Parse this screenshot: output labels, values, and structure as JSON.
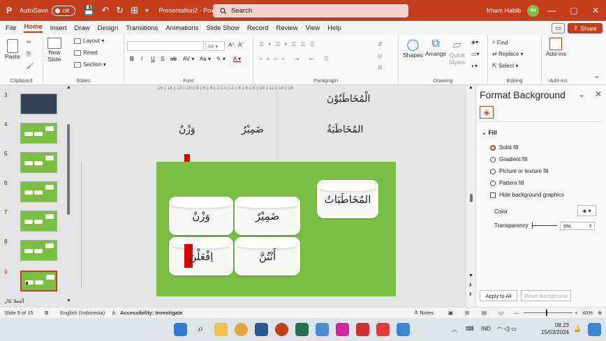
{
  "titlebar": {
    "autosave_label": "AutoSave",
    "autosave_state": "Off",
    "doc_name": "Presentation2 - PowerP...",
    "search_placeholder": "Search",
    "user_name": "Irham Habib",
    "user_initials": "IH"
  },
  "menu": {
    "items": [
      "File",
      "Home",
      "Insert",
      "Draw",
      "Design",
      "Transitions",
      "Animations",
      "Slide Show",
      "Record",
      "Review",
      "View",
      "Help"
    ],
    "share_label": "Share"
  },
  "ribbon": {
    "paste": "Paste",
    "new_slide": "New\nSlide",
    "layout": "Layout",
    "reset": "Reset",
    "section": "Section",
    "font_size": "54",
    "shapes": "Shapes",
    "arrange": "Arrange",
    "quick_styles": "Quick\nStyles",
    "find": "Find",
    "replace": "Replace",
    "select": "Select",
    "addins": "Add-ins",
    "groups": {
      "clipboard": "Clipboard",
      "slides": "Slides",
      "font": "Font",
      "paragraph": "Paragraph",
      "drawing": "Drawing",
      "editing": "Editing",
      "addins": "Add-ins"
    }
  },
  "thumbnails": {
    "numbers": [
      "3",
      "4",
      "5",
      "6",
      "7",
      "8",
      "9"
    ],
    "selected": "9",
    "bottom_label": "ألفعلا ثلال"
  },
  "canvas": {
    "ruler_text": "16·|·14·|·12·|·10·|·8·|·6·|·4·|·2·|·0·|·2·|·4·|·6·|·8·|·10·|·12·|·14·|·16",
    "bg_words": {
      "top": "الْمُخَاطَبُوْنَ",
      "col1": "المُخَاطَبَةُ",
      "col2": "ضَمِيْرٌ",
      "col3": "وَزْنٌ"
    },
    "slide": {
      "card_mukhatabat": "المُخَاطَبَاتُ",
      "card_dhamir": "ضَمِيْرٌ",
      "card_wazn": "وَزْنٌ",
      "card_antunna": "أَنْتُنَّ",
      "card_afalna": "اِفْعَلْنَ"
    }
  },
  "pane": {
    "title": "Format Background",
    "fill_header": "Fill",
    "options": {
      "solid": "Solid fill",
      "gradient": "Gradient fill",
      "picture": "Picture or texture fill",
      "pattern": "Pattern fill",
      "hide": "Hide background graphics"
    },
    "selected_option": "Solid fill",
    "color_label": "Color",
    "transparency_label": "Transparency",
    "transparency_value": "0%",
    "apply_all": "Apply to All",
    "reset_bg": "Reset Background"
  },
  "statusbar": {
    "slide_info": "Slide 9 of 15",
    "language": "English (Indonesia)",
    "accessibility": "Accessibility: Investigate",
    "notes": "Notes",
    "zoom": "40%"
  },
  "taskbar": {
    "lang": "IND",
    "time": "08.23",
    "date": "15/03/2024"
  },
  "colors": {
    "accent": "#c43e1c",
    "slide_green": "#7ac143",
    "title_bar": "#c43e1c"
  }
}
